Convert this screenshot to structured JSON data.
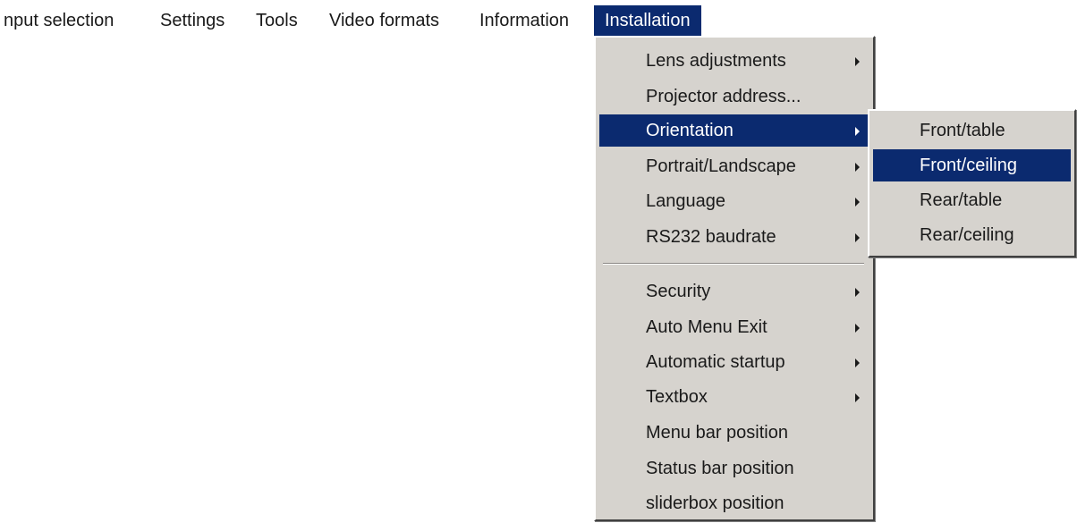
{
  "menubar": {
    "items": [
      {
        "label": "nput selection"
      },
      {
        "label": "Settings"
      },
      {
        "label": "Tools"
      },
      {
        "label": "Video formats"
      },
      {
        "label": "Information"
      },
      {
        "label": "Installation"
      }
    ],
    "active_index": 5
  },
  "installation_menu": {
    "items": [
      {
        "label": "Lens adjustments",
        "has_submenu": true
      },
      {
        "label": "Projector address...",
        "has_submenu": false
      },
      {
        "label": "Orientation",
        "has_submenu": true,
        "highlighted": true
      },
      {
        "label": "Portrait/Landscape",
        "has_submenu": true
      },
      {
        "label": "Language",
        "has_submenu": true
      },
      {
        "label": "RS232 baudrate",
        "has_submenu": true
      },
      {
        "label": "Security",
        "has_submenu": true
      },
      {
        "label": "Auto Menu Exit",
        "has_submenu": true
      },
      {
        "label": "Automatic startup",
        "has_submenu": true
      },
      {
        "label": "Textbox",
        "has_submenu": true
      },
      {
        "label": "Menu bar position",
        "has_submenu": false
      },
      {
        "label": "Status bar position",
        "has_submenu": false
      },
      {
        "label": "sliderbox position",
        "has_submenu": false
      }
    ]
  },
  "orientation_submenu": {
    "items": [
      {
        "label": "Front/table"
      },
      {
        "label": "Front/ceiling",
        "highlighted": true
      },
      {
        "label": "Rear/table"
      },
      {
        "label": "Rear/ceiling"
      }
    ]
  },
  "colors": {
    "menu_background": "#d6d3ce",
    "highlight": "#0b2a6f",
    "highlight_text": "#ffffff",
    "text": "#1a1a1a"
  },
  "icons": {
    "submenu_arrow": "triangle-right-icon"
  }
}
